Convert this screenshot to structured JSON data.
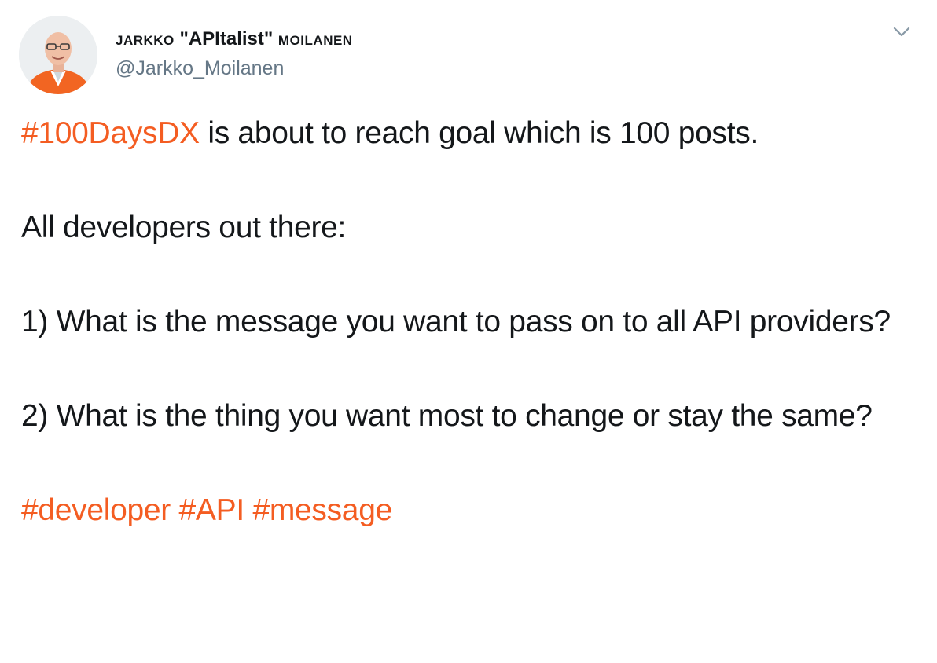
{
  "author": {
    "name_start": "Jarkko",
    "name_mid": " \"APItalist\" ",
    "name_end": "Moilanen",
    "handle": "@Jarkko_Moilanen"
  },
  "tweet": {
    "line1_hashtag": "#100DaysDX",
    "line1_rest": " is about to reach goal which is 100 posts.",
    "line2": "All developers out there:",
    "line3": "1) What is the message you want to pass on to all API providers?",
    "line4": "2) What is the thing you want most to change or stay the same?",
    "hashtags": [
      "#developer",
      "#API",
      "#message"
    ]
  },
  "colors": {
    "accent": "#f45d22",
    "text": "#14171a",
    "secondary": "#657786"
  },
  "icons": {
    "menu": "chevron-down-icon"
  }
}
